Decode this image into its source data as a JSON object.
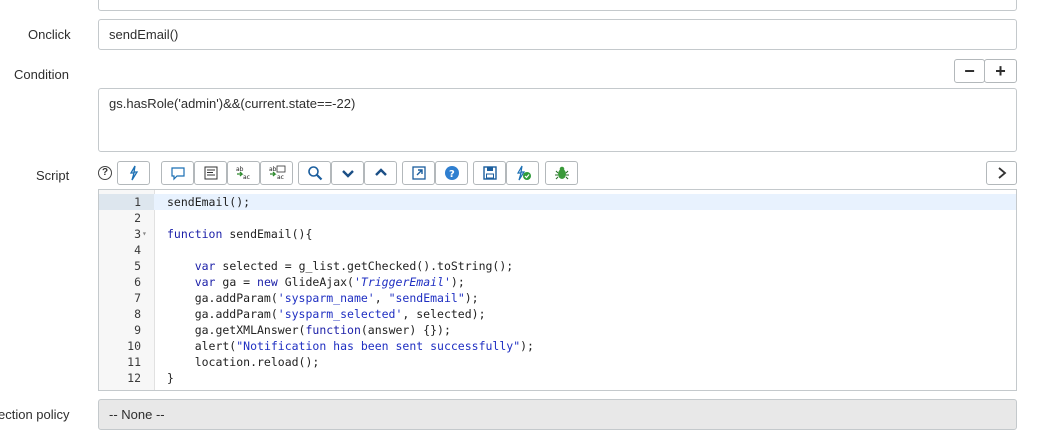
{
  "form": {
    "onclick": {
      "label": "Onclick",
      "value": "sendEmail()"
    },
    "condition": {
      "label": "Condition",
      "value": "gs.hasRole('admin')&&(current.state==-22)"
    },
    "script": {
      "label": "Script"
    },
    "selection_policy": {
      "label": "ection policy",
      "value": "-- None --"
    }
  },
  "toolbar": {
    "help": "help-icon",
    "buttons": [
      "toggle-syntax-icon",
      "comment-icon",
      "format-icon",
      "replace-icon",
      "replace-all-icon",
      "search-icon",
      "find-next-icon",
      "find-previous-icon",
      "fullscreen-icon",
      "script-help-icon",
      "save-icon",
      "check-syntax-icon",
      "debug-icon",
      "expand-panel-icon"
    ]
  },
  "editor": {
    "lines": [
      {
        "n": "1",
        "code": "sendEmail();"
      },
      {
        "n": "2",
        "code": ""
      },
      {
        "n": "3",
        "code": "function sendEmail(){"
      },
      {
        "n": "4",
        "code": ""
      },
      {
        "n": "5",
        "code": "    var selected = g_list.getChecked().toString();"
      },
      {
        "n": "6",
        "code": "    var ga = new GlideAjax('TriggerEmail');"
      },
      {
        "n": "7",
        "code": "    ga.addParam('sysparm_name', \"sendEmail\");"
      },
      {
        "n": "8",
        "code": "    ga.addParam('sysparm_selected', selected);"
      },
      {
        "n": "9",
        "code": "    ga.getXMLAnswer(function(answer) {});"
      },
      {
        "n": "10",
        "code": "    alert(\"Notification has been sent successfully\");"
      },
      {
        "n": "11",
        "code": "    location.reload();"
      },
      {
        "n": "12",
        "code": "}"
      }
    ],
    "active_line": "1",
    "colors": {
      "keyword": "#1b1fa8",
      "string": "#1f2fc2",
      "active_line_bg": "#e8f2fe",
      "gutter_bg": "#f7f7f7"
    }
  },
  "condition_controls": {
    "minus": "−",
    "plus": "+"
  }
}
